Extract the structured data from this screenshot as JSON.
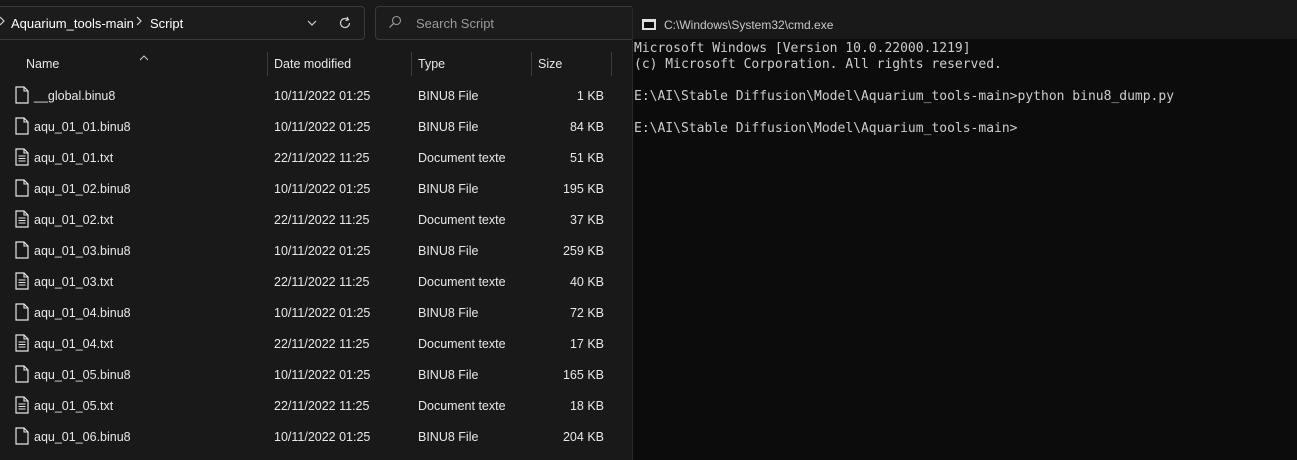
{
  "explorer": {
    "breadcrumb": [
      "Aquarium_tools-main",
      "Script"
    ],
    "search": {
      "placeholder": "Search Script"
    },
    "columns": {
      "name": "Name",
      "date": "Date modified",
      "type": "Type",
      "size": "Size"
    },
    "files": [
      {
        "name": "__global.binu8",
        "date": "10/11/2022 01:25",
        "type": "BINU8 File",
        "size": "1 KB"
      },
      {
        "name": "aqu_01_01.binu8",
        "date": "10/11/2022 01:25",
        "type": "BINU8 File",
        "size": "84 KB"
      },
      {
        "name": "aqu_01_01.txt",
        "date": "22/11/2022 11:25",
        "type": "Document texte",
        "size": "51 KB"
      },
      {
        "name": "aqu_01_02.binu8",
        "date": "10/11/2022 01:25",
        "type": "BINU8 File",
        "size": "195 KB"
      },
      {
        "name": "aqu_01_02.txt",
        "date": "22/11/2022 11:25",
        "type": "Document texte",
        "size": "37 KB"
      },
      {
        "name": "aqu_01_03.binu8",
        "date": "10/11/2022 01:25",
        "type": "BINU8 File",
        "size": "259 KB"
      },
      {
        "name": "aqu_01_03.txt",
        "date": "22/11/2022 11:25",
        "type": "Document texte",
        "size": "40 KB"
      },
      {
        "name": "aqu_01_04.binu8",
        "date": "10/11/2022 01:25",
        "type": "BINU8 File",
        "size": "72 KB"
      },
      {
        "name": "aqu_01_04.txt",
        "date": "22/11/2022 11:25",
        "type": "Document texte",
        "size": "17 KB"
      },
      {
        "name": "aqu_01_05.binu8",
        "date": "10/11/2022 01:25",
        "type": "BINU8 File",
        "size": "165 KB"
      },
      {
        "name": "aqu_01_05.txt",
        "date": "22/11/2022 11:25",
        "type": "Document texte",
        "size": "18 KB"
      },
      {
        "name": "aqu_01_06.binu8",
        "date": "10/11/2022 01:25",
        "type": "BINU8 File",
        "size": "204 KB"
      }
    ]
  },
  "cmd": {
    "title": "C:\\Windows\\System32\\cmd.exe",
    "lines": [
      "Microsoft Windows [Version 10.0.22000.1219]",
      "(c) Microsoft Corporation. All rights reserved.",
      "",
      "E:\\AI\\Stable Diffusion\\Model\\Aquarium_tools-main>python binu8_dump.py",
      "",
      "E:\\AI\\Stable Diffusion\\Model\\Aquarium_tools-main>"
    ]
  },
  "icons": [
    "chevron-right-icon",
    "chevron-down-icon",
    "refresh-icon",
    "search-icon",
    "sort-up-icon",
    "file-icon",
    "cmd-app-icon"
  ],
  "colors": {
    "explorer_bg": "#191919",
    "cmd_bg": "#0c0c0c",
    "cmd_text": "#cccccc",
    "text": "#ffffff"
  }
}
